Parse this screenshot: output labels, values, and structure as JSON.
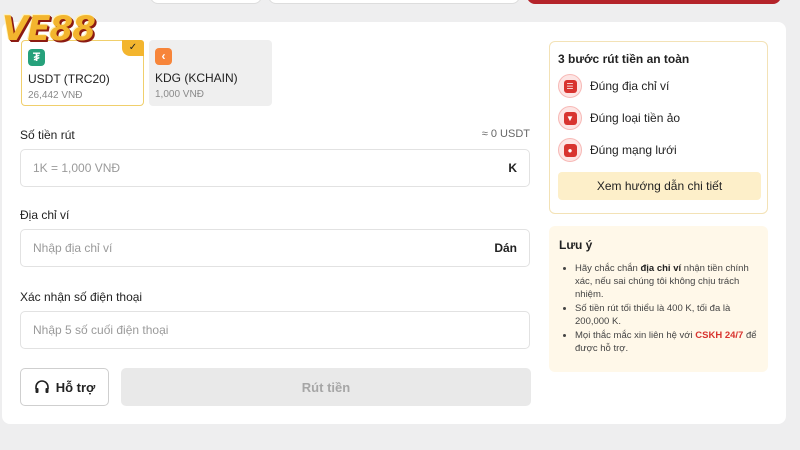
{
  "brand": {
    "logo_text": "VE88"
  },
  "currencies": [
    {
      "name": "USDT (TRC20)",
      "value": "26,442 VNĐ",
      "icon": "usdt-icon",
      "icon_glyph": "₮",
      "selected": true
    },
    {
      "name": "KDG (KCHAIN)",
      "value": "1,000 VNĐ",
      "icon": "kdg-icon",
      "icon_glyph": "‹",
      "selected": false
    }
  ],
  "form": {
    "amount": {
      "label": "Số tiền rút",
      "converted": "≈ 0 USDT",
      "placeholder": "1K = 1,000 VNĐ",
      "suffix": "K"
    },
    "wallet": {
      "label": "Địa chỉ ví",
      "placeholder": "Nhập địa chỉ ví",
      "suffix": "Dán"
    },
    "phone": {
      "label": "Xác nhận số điện thoại",
      "placeholder": "Nhập 5 số cuối điện thoại"
    },
    "support_label": "Hỗ trợ",
    "submit_label": "Rút tiền"
  },
  "steps": {
    "title": "3 bước rút tiền an toàn",
    "items": [
      {
        "label": "Đúng địa chỉ ví",
        "icon": "wallet-check-icon"
      },
      {
        "label": "Đúng loại tiền ảo",
        "icon": "crypto-type-icon"
      },
      {
        "label": "Đúng mạng lưới",
        "icon": "network-icon"
      }
    ],
    "guide_label": "Xem hướng dẫn chi tiết"
  },
  "notes": {
    "title": "Lưu ý",
    "item1_pre": "Hãy chắc chắn ",
    "item1_bold": "địa chỉ ví",
    "item1_post": " nhận tiền chính xác, nếu sai chúng tôi không chịu trách nhiệm.",
    "item2": "Số tiền rút tối thiểu là 400 K, tối đa là 200,000 K.",
    "item3_pre": "Mọi thắc mắc xin liên hệ với ",
    "item3_link": "CSKH 24/7",
    "item3_post": " để được hỗ trợ."
  },
  "colors": {
    "accent": "#f3b52e",
    "danger": "#d8342f",
    "usdt": "#26a17b",
    "kdg": "#f7853a"
  }
}
